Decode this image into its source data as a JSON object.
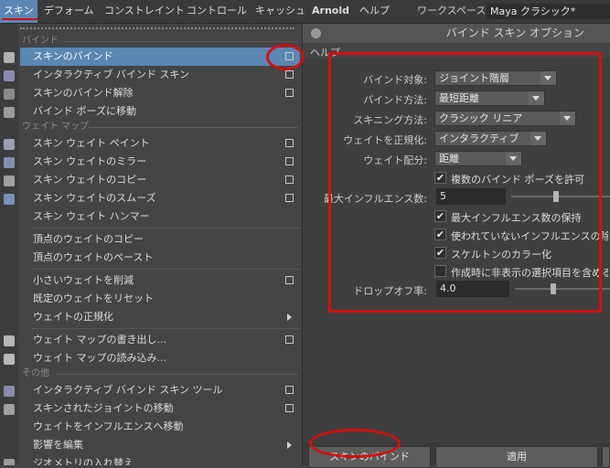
{
  "menubar": {
    "items": [
      "スキン",
      "デフォーム",
      "コンストレイント",
      "コントロール",
      "キャッシュ",
      "Arnold",
      "ヘルプ"
    ],
    "workspace_label": "ワークスペース:",
    "workspace_value": "Maya クラシック*"
  },
  "menu": {
    "section_bind": "バインド",
    "section_weightmap": "ウェイト マップ",
    "section_other": "その他",
    "items": [
      {
        "label": "スキンのバインド",
        "option": true,
        "highlighted": true
      },
      {
        "label": "インタラクティブ バインド スキン",
        "option": true
      },
      {
        "label": "スキンのバインド解除",
        "option": true
      },
      {
        "label": "バインド ポーズに移動"
      },
      {
        "label": "スキン ウェイト ペイント",
        "option": true
      },
      {
        "label": "スキン ウェイトのミラー",
        "option": true
      },
      {
        "label": "スキン ウェイトのコピー",
        "option": true
      },
      {
        "label": "スキン ウェイトのスムーズ",
        "option": true
      },
      {
        "label": "スキン ウェイト ハンマー"
      },
      {
        "label": "頂点のウェイトのコピー"
      },
      {
        "label": "頂点のウェイトのペースト"
      },
      {
        "label": "小さいウェイトを削減",
        "option": true
      },
      {
        "label": "既定のウェイトをリセット"
      },
      {
        "label": "ウェイトの正規化",
        "submenu": true
      },
      {
        "label": "ウェイト マップの書き出し...",
        "option": true
      },
      {
        "label": "ウェイト マップの読み込み..."
      },
      {
        "label": "インタラクティブ バインド スキン ツール",
        "option": true
      },
      {
        "label": "スキンされたジョイントの移動",
        "option": true
      },
      {
        "label": "ウェイトをインフルエンスへ移動"
      },
      {
        "label": "影響を編集",
        "submenu": true
      },
      {
        "label": "ジオメトリの入れ替え"
      }
    ]
  },
  "dialog": {
    "title": "バインド スキン オプション",
    "help": "ヘルプ",
    "bind_to_label": "バインド対象:",
    "bind_to_value": "ジョイント階層",
    "bind_method_label": "バインド方法:",
    "bind_method_value": "最短距離",
    "skinning_method_label": "スキニング方法:",
    "skinning_method_value": "クラシック リニア",
    "normalize_label": "ウェイトを正規化:",
    "normalize_value": "インタラクティブ",
    "distribution_label": "ウェイト配分:",
    "distribution_value": "距離",
    "multi_pose_label": "複数のバインド ポーズを許可",
    "max_influences_label": "最大インフルエンス数:",
    "max_influences_value": "5",
    "max_influences_slider": 0.45,
    "maintain_max_label": "最大インフルエンス数の保持",
    "remove_unused_label": "使われていないインフルエンスの除去",
    "colorize_label": "スケルトンのカラー化",
    "include_hidden_label": "作成時に非表示の選択項目を含める",
    "dropoff_label": "ドロップオフ率:",
    "dropoff_value": "4.0",
    "dropoff_slider": 0.4,
    "checks": {
      "multi_pose": true,
      "maintain_max": true,
      "remove_unused": true,
      "colorize": true,
      "include_hidden": false
    },
    "bind_button": "スキンのバインド",
    "apply_button": "適用"
  },
  "colors": {
    "highlight": "#5a87b3",
    "annotation": "#d01010"
  }
}
